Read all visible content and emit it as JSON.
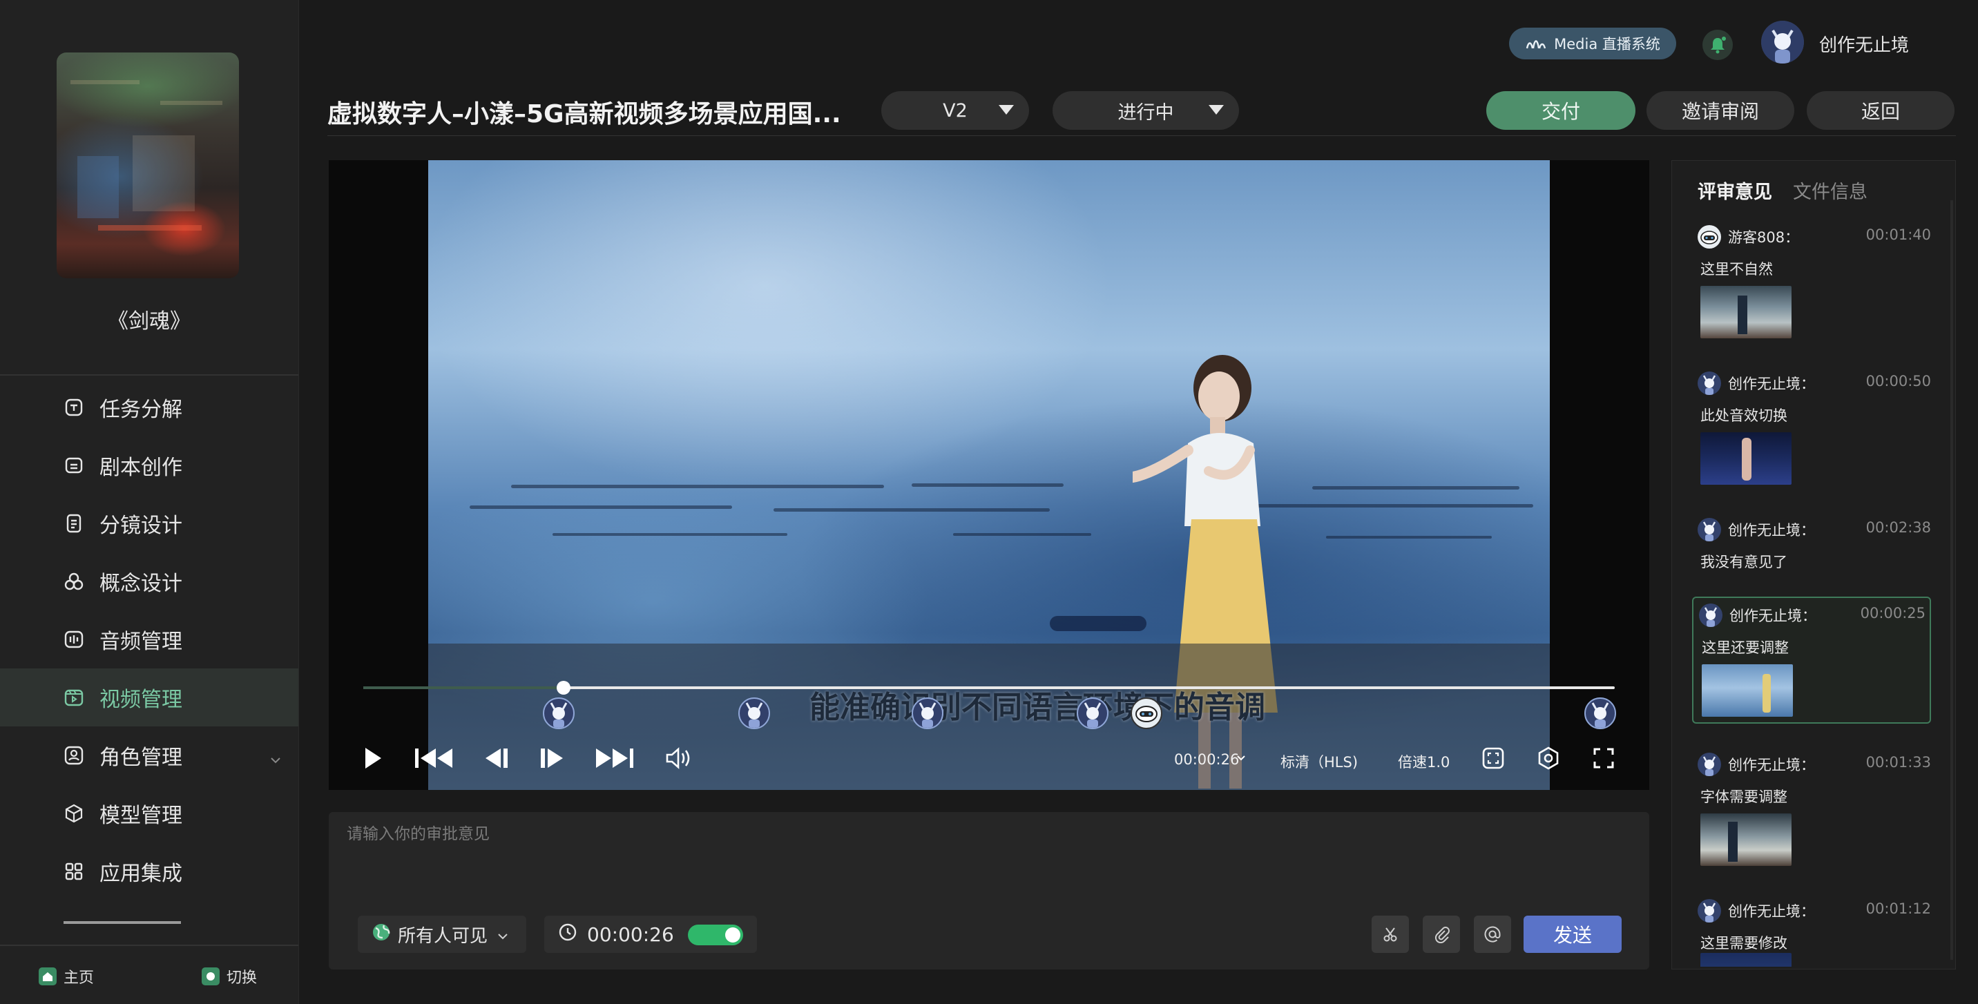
{
  "sidebar": {
    "project_title": "《剑魂》",
    "items": [
      {
        "label": "任务分解",
        "icon": "task-icon"
      },
      {
        "label": "剧本创作",
        "icon": "script-icon"
      },
      {
        "label": "分镜设计",
        "icon": "storyboard-icon"
      },
      {
        "label": "概念设计",
        "icon": "concept-icon"
      },
      {
        "label": "音频管理",
        "icon": "audio-icon"
      },
      {
        "label": "视频管理",
        "icon": "video-icon",
        "active": true
      },
      {
        "label": "角色管理",
        "icon": "role-icon"
      },
      {
        "label": "模型管理",
        "icon": "model-icon"
      },
      {
        "label": "应用集成",
        "icon": "app-icon"
      }
    ],
    "footer": {
      "home_label": "主页",
      "switch_label": "切换"
    }
  },
  "topbar": {
    "system_badge": "Media 直播系统",
    "username": "创作无止境"
  },
  "header": {
    "video_title": "虚拟数字人–小漾–5G高新视频多场景应用国...",
    "version_select": "V2",
    "status_select": "进行中",
    "deliver_label": "交付",
    "invite_label": "邀请审阅",
    "back_label": "返回"
  },
  "player": {
    "subtitle": "能准确识别不同语言环境下的音调",
    "progress": 0.16,
    "current_time": "00:00:26",
    "quality": "标清（HLS)",
    "speed": "倍速1.0"
  },
  "comment": {
    "placeholder": "请输入你的审批意见",
    "visibility": "所有人可见",
    "timestamp": "00:00:26",
    "send_label": "发送"
  },
  "review_panel": {
    "tabs": [
      "评审意见",
      "文件信息"
    ],
    "comments": [
      {
        "author": "游客808：",
        "time": "00:01:40",
        "text": "这里不自然",
        "has_thumb": true
      },
      {
        "author": "创作无止境：",
        "time": "00:00:50",
        "text": "此处音效切换",
        "has_thumb": true
      },
      {
        "author": "创作无止境：",
        "time": "00:02:38",
        "text": "我没有意见了",
        "has_thumb": false
      },
      {
        "author": "创作无止境：",
        "time": "00:00:25",
        "text": "这里还要调整",
        "has_thumb": true
      },
      {
        "author": "创作无止境：",
        "time": "00:01:33",
        "text": "字体需要调整",
        "has_thumb": true
      },
      {
        "author": "创作无止境：",
        "time": "00:01:12",
        "text": "这里需要修改",
        "has_thumb": true
      }
    ]
  },
  "colors": {
    "accent_green": "#7bc9a4",
    "deliver_button": "#4e8f6b",
    "send_button": "#5a73c8",
    "toggle_on": "#2fb76a"
  }
}
